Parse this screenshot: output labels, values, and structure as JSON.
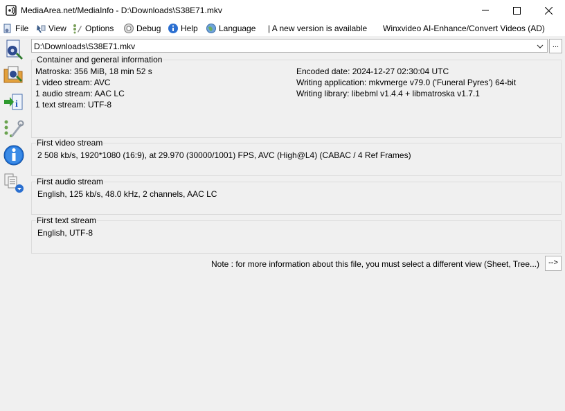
{
  "window": {
    "title": "MediaArea.net/MediaInfo - D:\\Downloads\\S38E71.mkv"
  },
  "menu": {
    "file": "File",
    "view": "View",
    "options": "Options",
    "debug": "Debug",
    "help": "Help",
    "language": "Language",
    "new_version": "| A new version is available",
    "ad": "Winxvideo AI-Enhance/Convert Videos (AD)"
  },
  "file_selector": {
    "path": "D:\\Downloads\\S38E71.mkv",
    "browse_label": "..."
  },
  "general": {
    "title": "Container and general information",
    "left": [
      "Matroska: 356 MiB, 18 min 52 s",
      "1 video stream: AVC",
      "1 audio stream: AAC LC",
      "1 text stream: UTF-8"
    ],
    "right": [
      "Encoded date: 2024-12-27 02:30:04 UTC",
      "Writing application: mkvmerge v79.0 ('Funeral Pyres') 64-bit",
      "Writing library: libebml v1.4.4 + libmatroska v1.7.1"
    ]
  },
  "video": {
    "title": "First video stream",
    "text": "2 508 kb/s, 1920*1080 (16:9), at 29.970 (30000/1001) FPS, AVC (High@L4) (CABAC / 4 Ref Frames)"
  },
  "audio": {
    "title": "First audio stream",
    "text": "English, 125 kb/s, 48.0 kHz, 2 channels, AAC LC"
  },
  "text_stream": {
    "title": "First text stream",
    "text": "English, UTF-8"
  },
  "note": {
    "text": "Note : for more information about this file, you must select a different view (Sheet, Tree...)",
    "button": "-->"
  },
  "icons": {
    "app": "mediainfo-logo-icon",
    "minimize": "minimize-icon",
    "maximize": "maximize-icon",
    "close": "close-icon",
    "sidebar": [
      "open-file-icon",
      "open-folder-icon",
      "export-icon",
      "preferences-icon",
      "about-icon",
      "knowledge-base-icon"
    ]
  }
}
